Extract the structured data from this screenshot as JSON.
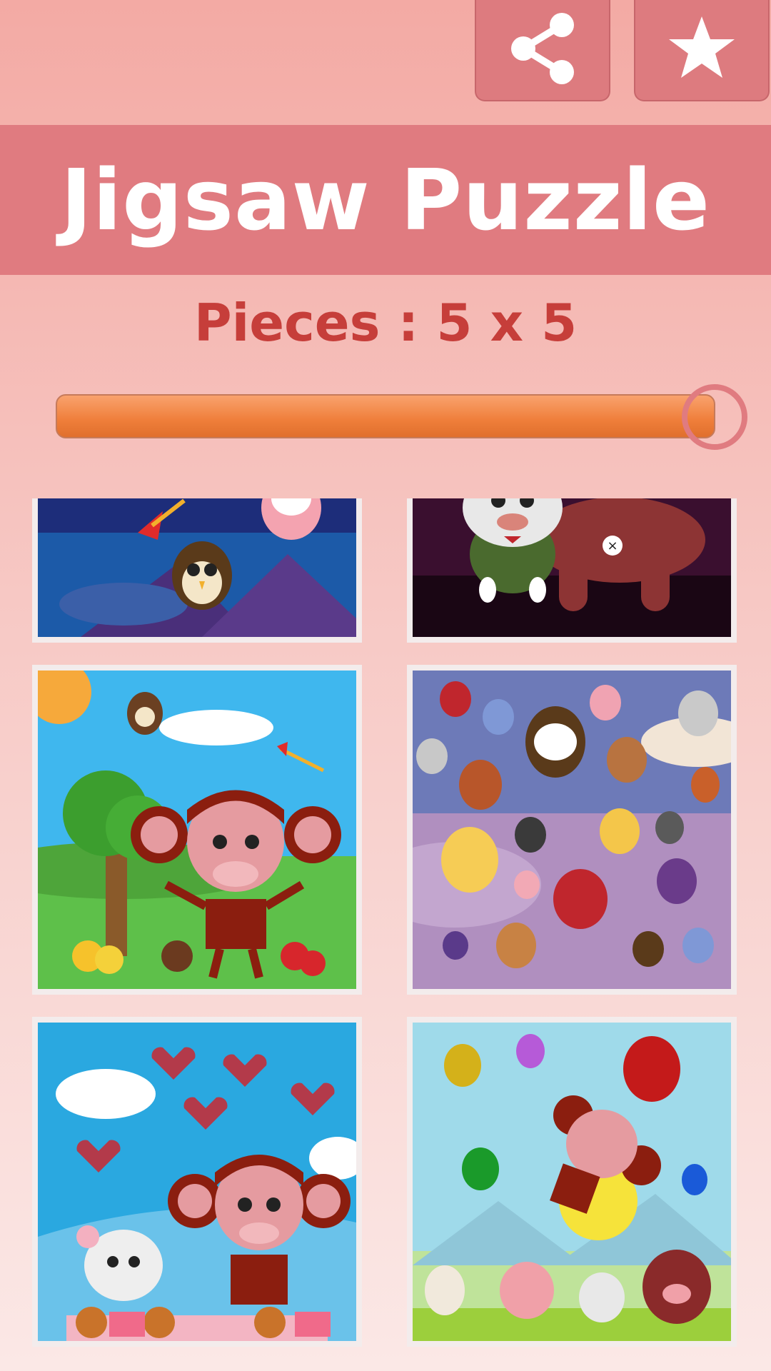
{
  "header": {
    "share_icon": "share-icon",
    "star_icon": "star-icon",
    "title": "Jigsaw Puzzle"
  },
  "settings": {
    "pieces_label": "Pieces : 5 x 5",
    "pieces_slider_level": 1.0
  },
  "gallery": {
    "items": [
      {
        "name": "owls-night-sky"
      },
      {
        "name": "bunny-bear-night"
      },
      {
        "name": "monkey-meadow"
      },
      {
        "name": "owls-evening-sky"
      },
      {
        "name": "monkey-hearts-sweets"
      },
      {
        "name": "monkey-balloons-friends"
      }
    ]
  },
  "colors": {
    "title_bar": "#e07b80",
    "pieces_text": "#c63e3a",
    "slider_fill": "#ef7e3a",
    "background_top": "#f3aaa4"
  }
}
